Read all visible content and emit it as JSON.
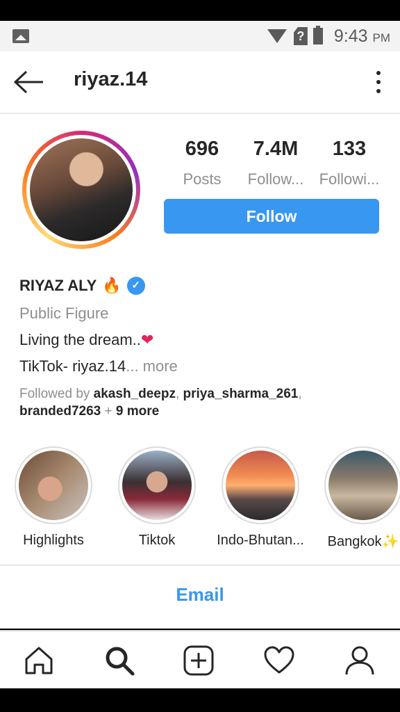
{
  "status_bar": {
    "time": "9:43",
    "ampm": "PM"
  },
  "header": {
    "username": "riyaz.14"
  },
  "profile": {
    "stats": [
      {
        "value": "696",
        "label": "Posts"
      },
      {
        "value": "7.4M",
        "label": "Follow..."
      },
      {
        "value": "133",
        "label": "Followi..."
      }
    ],
    "follow_label": "Follow",
    "name": "RIYAZ ALY",
    "fire_emoji": "🔥",
    "verified_mark": "✓",
    "category": "Public Figure",
    "bio_line1": "Living the dream..",
    "heart_emoji": "❤",
    "bio_line2": "TikTok- riyaz.14",
    "more_label": "... more",
    "followed_prefix": "Followed by ",
    "followed_user1": "akash_deepz",
    "followed_sep": ", ",
    "followed_user2": "priya_sharma_261",
    "followed_sep2": ",",
    "followed_user3": "branded7263",
    "followed_plus": " + ",
    "followed_more": "9 more"
  },
  "highlights": [
    {
      "label": "Highlights"
    },
    {
      "label": "Tiktok"
    },
    {
      "label": "Indo-Bhutan..."
    },
    {
      "label": "Bangkok✨"
    }
  ],
  "email_label": "Email",
  "colors": {
    "accent": "#3897f0",
    "text": "#262626",
    "muted": "#8e8e8e"
  },
  "nav_icons": [
    "home-icon",
    "search-icon",
    "add-icon",
    "heart-icon",
    "profile-icon"
  ]
}
